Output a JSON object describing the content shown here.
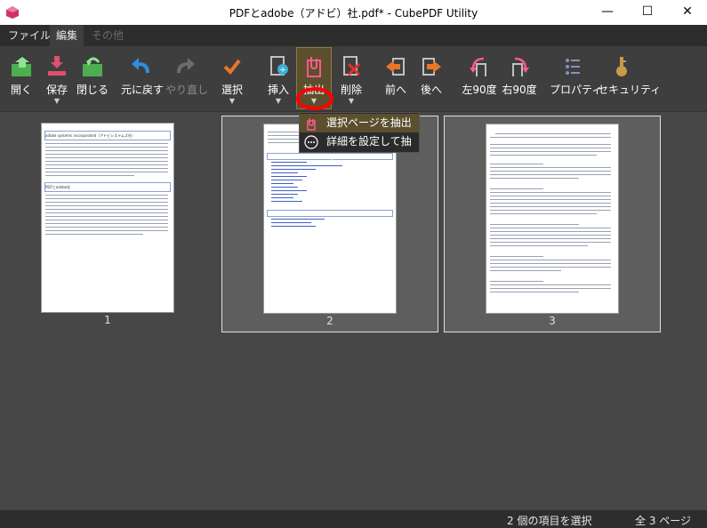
{
  "window": {
    "title": "PDFとadobe（アドビ）社.pdf* - CubePDF Utility",
    "min": "—",
    "max": "☐",
    "close": "✕"
  },
  "menu": {
    "tabs": [
      "ファイル",
      "編集",
      "その他"
    ]
  },
  "ribbon": {
    "open": "開く",
    "save": "保存",
    "close": "閉じる",
    "undo": "元に戻す",
    "redo": "やり直し",
    "select": "選択",
    "insert": "挿入",
    "extract": "抽出",
    "delete": "削除",
    "prev": "前へ",
    "next": "後へ",
    "rotate_left": "左90度",
    "rotate_right": "右90度",
    "properties": "プロパティ",
    "security": "セキュリティ"
  },
  "dropdown": {
    "item1": "選択ページを抽出",
    "item2": "詳細を設定して抽出"
  },
  "pages": [
    {
      "num": "1",
      "heading1": "adobe systems incorporated（アドビシステムズ社）",
      "heading2": "PDFとadobe社"
    },
    {
      "num": "2"
    },
    {
      "num": "3"
    }
  ],
  "status": {
    "selected": "2 個の項目を選択",
    "total": "全 3 ページ"
  },
  "colors": {
    "accent": "#f0c040",
    "highlight": "#5b4f2e",
    "bg": "#474747"
  }
}
